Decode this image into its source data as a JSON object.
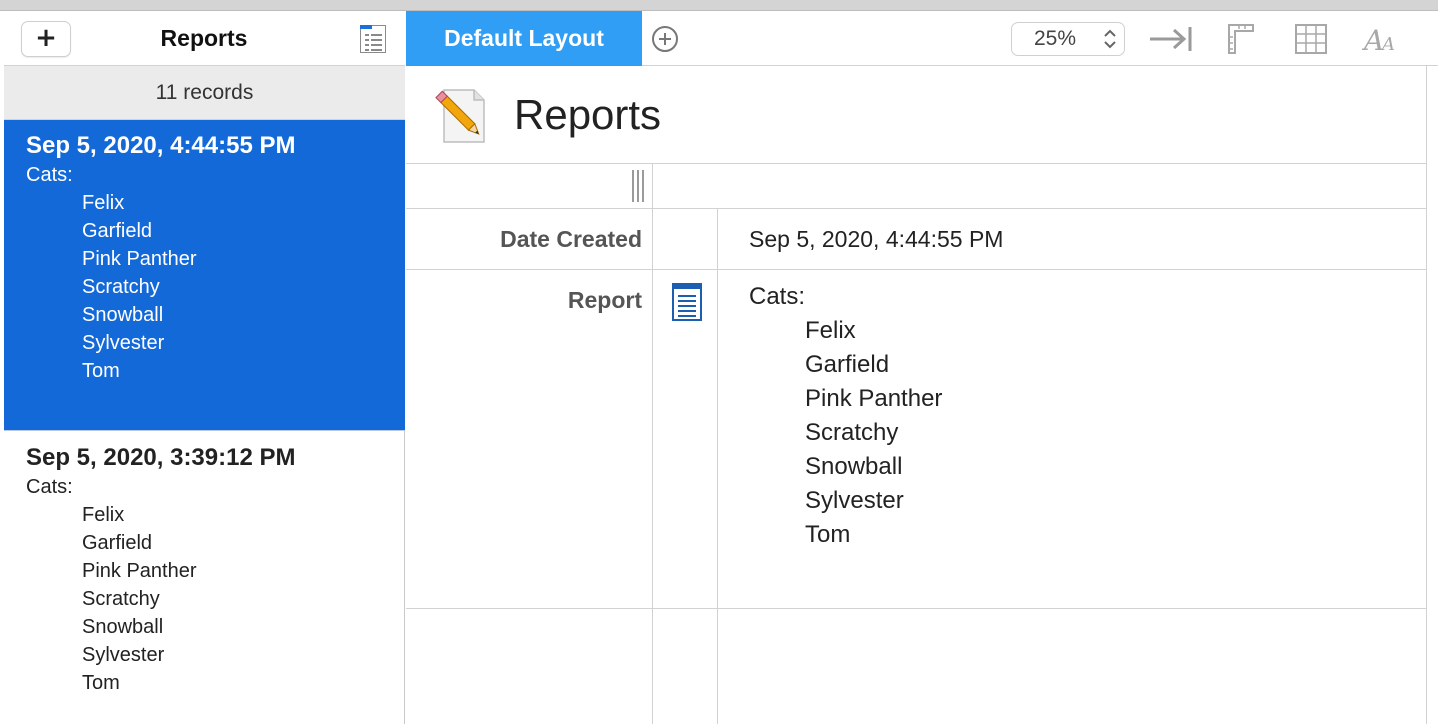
{
  "sidebar": {
    "add_label": "+",
    "title": "Reports",
    "records_count": "11 records",
    "records": [
      {
        "date": "Sep 5, 2020, 4:44:55 PM",
        "cats_label": "Cats:",
        "cats": [
          "Felix",
          "Garfield",
          "Pink Panther",
          "Scratchy",
          "Snowball",
          "Sylvester",
          "Tom"
        ]
      },
      {
        "date": "Sep 5, 2020, 3:39:12 PM",
        "cats_label": "Cats:",
        "cats": [
          "Felix",
          "Garfield",
          "Pink Panther",
          "Scratchy",
          "Snowball",
          "Sylvester",
          "Tom"
        ]
      }
    ]
  },
  "toolbar": {
    "tab_label": "Default Layout",
    "zoom": "25%"
  },
  "document": {
    "title": "Reports",
    "fields": {
      "date_created_label": "Date Created",
      "date_created_value": "Sep 5, 2020, 4:44:55 PM",
      "report_label": "Report",
      "report_cats_label": "Cats:",
      "report_cats": [
        "Felix",
        "Garfield",
        "Pink Panther",
        "Scratchy",
        "Snowball",
        "Sylvester",
        "Tom"
      ]
    }
  },
  "colors": {
    "selection": "#1469d8",
    "tab_active": "#2f9ef4",
    "note_icon": "#1c5fb0"
  },
  "icons": {
    "list_view": "list-view-icon",
    "add_tab": "add-tab-icon",
    "arrow_to_bar": "arrow-to-bar-icon",
    "ruler": "ruler-icon",
    "grid": "grid-icon",
    "font": "font-icon",
    "document": "document-pencil-icon",
    "note": "note-icon"
  }
}
